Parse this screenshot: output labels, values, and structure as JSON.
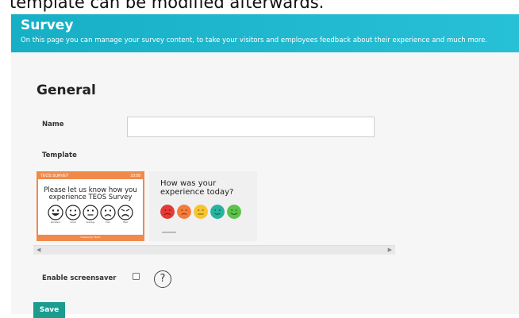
{
  "caption": "template can be modified afterwards.",
  "header": {
    "title": "Survey",
    "subtitle": "On this page you can manage your survey content, to take your visitors and employees feedback about their experience and much more."
  },
  "general": {
    "title": "General",
    "name_label": "Name",
    "name_value": "",
    "template_label": "Template",
    "screensaver_label": "Enable screensaver",
    "help_symbol": "?",
    "save_label": "Save"
  },
  "templates": [
    {
      "brand": "TEOS SURVEY",
      "time": "10:58",
      "message": "Please let us know how you experience TEOS Survey",
      "faces": [
        "Excellent",
        "Good",
        "Average",
        "Poor",
        "Bad"
      ],
      "footer": "Powered by TEOS"
    },
    {
      "question": "How was your experience today?",
      "colors": [
        "#e53935",
        "#f57c3b",
        "#f5c431",
        "#26b3a0",
        "#5bc24a"
      ]
    }
  ],
  "colors": {
    "header": "#17afc5",
    "accent_orange": "#f08a4b",
    "save": "#1a9c8f"
  }
}
